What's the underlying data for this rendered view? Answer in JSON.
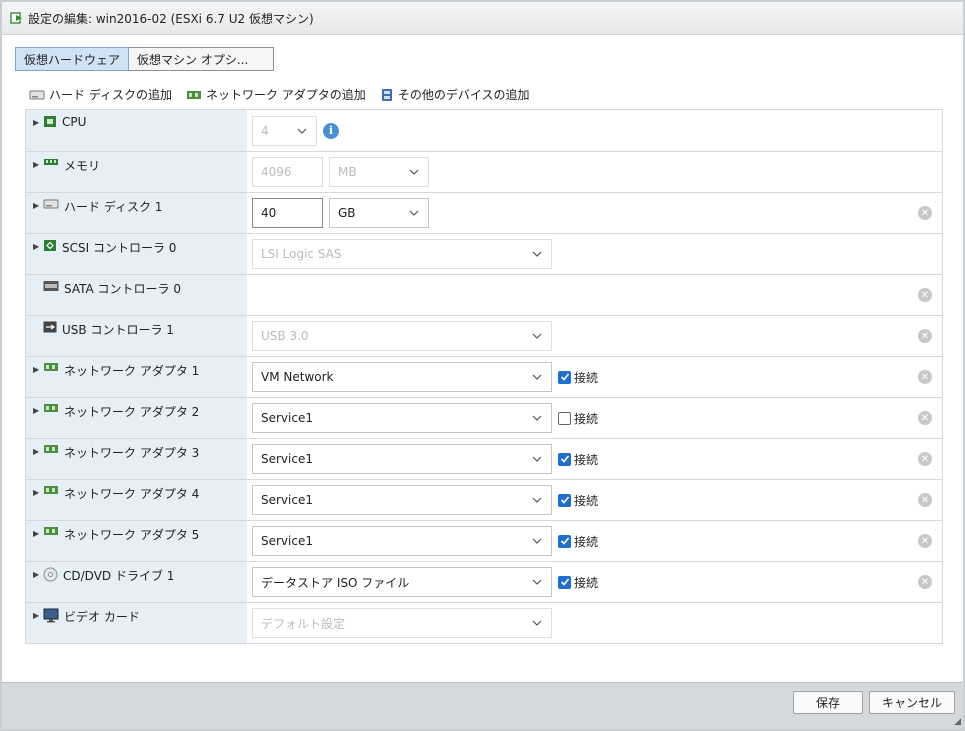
{
  "window": {
    "title": "設定の編集: win2016-02 (ESXi 6.7 U2 仮想マシン)"
  },
  "tabs": [
    {
      "label": "仮想ハードウェア",
      "active": true
    },
    {
      "label": "仮想マシン オプシ..."
    }
  ],
  "add_bar": {
    "hard_disk": "ハード ディスクの追加",
    "network_adapter": "ネットワーク アダプタの追加",
    "other_device": "その他のデバイスの追加"
  },
  "rows": {
    "cpu": {
      "label": "CPU",
      "value": "4"
    },
    "memory": {
      "label": "メモリ",
      "size": "4096",
      "unit": "MB"
    },
    "disk": {
      "label": "ハード ディスク 1",
      "size": "40",
      "unit": "GB"
    },
    "scsi": {
      "label": "SCSI コントローラ 0",
      "value": "LSI Logic SAS"
    },
    "sata": {
      "label": "SATA コントローラ 0"
    },
    "usb": {
      "label": "USB コントローラ 1",
      "value": "USB 3.0"
    },
    "net1": {
      "label": "ネットワーク アダプタ 1",
      "value": "VM Network",
      "connect_label": "接続",
      "connected": true
    },
    "net2": {
      "label": "ネットワーク アダプタ 2",
      "value": "Service1",
      "connect_label": "接続",
      "connected": false
    },
    "net3": {
      "label": "ネットワーク アダプタ 3",
      "value": "Service1",
      "connect_label": "接続",
      "connected": true
    },
    "net4": {
      "label": "ネットワーク アダプタ 4",
      "value": "Service1",
      "connect_label": "接続",
      "connected": true
    },
    "net5": {
      "label": "ネットワーク アダプタ 5",
      "value": "Service1",
      "connect_label": "接続",
      "connected": true
    },
    "cdrom": {
      "label": "CD/DVD ドライブ 1",
      "value": "データストア ISO ファイル",
      "connect_label": "接続",
      "connected": true
    },
    "video": {
      "label": "ビデオ カード",
      "value": "デフォルト設定"
    }
  },
  "footer": {
    "save": "保存",
    "cancel": "キャンセル"
  },
  "colors": {
    "accent": "#1f6fd1",
    "label_bg": "#e6eef6",
    "footer_bg": "#d6d9dc"
  }
}
